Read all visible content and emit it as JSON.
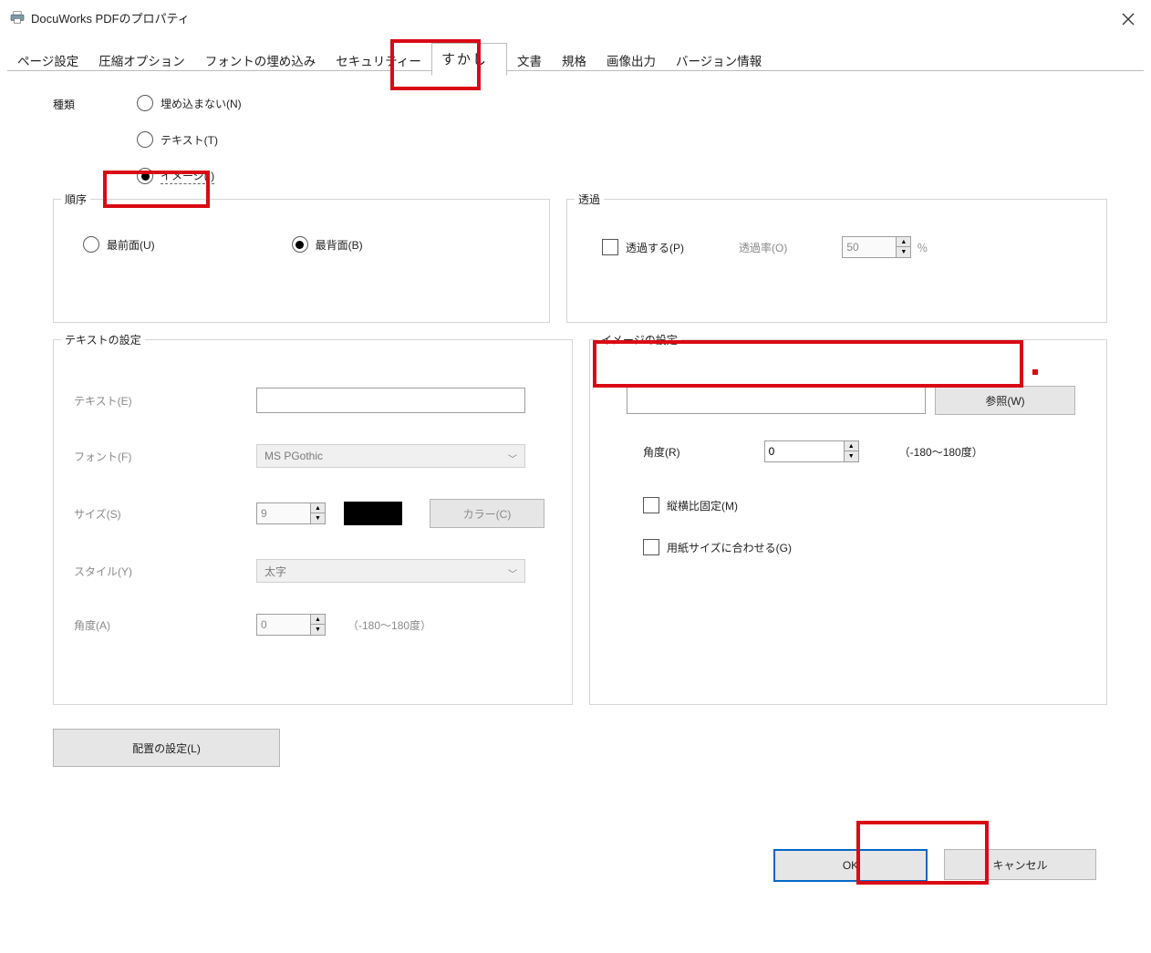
{
  "window": {
    "title": "DocuWorks PDFのプロパティ"
  },
  "tabs": [
    "ページ設定",
    "圧縮オプション",
    "フォントの埋め込み",
    "セキュリティー",
    "すかし",
    "文書",
    "規格",
    "画像出力",
    "バージョン情報"
  ],
  "active_tab_index": 4,
  "kind": {
    "label": "種類",
    "options": [
      {
        "label": "埋め込まない(N)",
        "checked": false
      },
      {
        "label": "テキスト(T)",
        "checked": false
      },
      {
        "label": "イメージ(I)",
        "checked": true
      }
    ]
  },
  "order": {
    "legend": "順序",
    "front": {
      "label": "最前面(U)",
      "checked": false
    },
    "back": {
      "label": "最背面(B)",
      "checked": true
    }
  },
  "transparency": {
    "legend": "透過",
    "enable": {
      "label": "透過する(P)",
      "checked": false
    },
    "rate_label": "透過率(O)",
    "rate_value": "50",
    "unit": "％"
  },
  "text_settings": {
    "legend": "テキストの設定",
    "text_label": "テキスト(E)",
    "text_value": "",
    "font_label": "フォント(F)",
    "font_value": "MS PGothic",
    "size_label": "サイズ(S)",
    "size_value": "9",
    "color_label": "カラー(C)",
    "style_label": "スタイル(Y)",
    "style_value": "太字",
    "angle_label": "角度(A)",
    "angle_value": "0",
    "angle_range": "（-180～180度）"
  },
  "image_settings": {
    "legend": "イメージの設定",
    "path_value": "",
    "browse_label": "参照(W)",
    "angle_label": "角度(R)",
    "angle_value": "0",
    "angle_range": "（-180～180度）",
    "keep_aspect": "縦横比固定(M)",
    "fit_to_paper": "用紙サイズに合わせる(G)"
  },
  "placement_button": "配置の設定(L)",
  "footer": {
    "ok": "OK",
    "cancel": "キャンセル"
  }
}
